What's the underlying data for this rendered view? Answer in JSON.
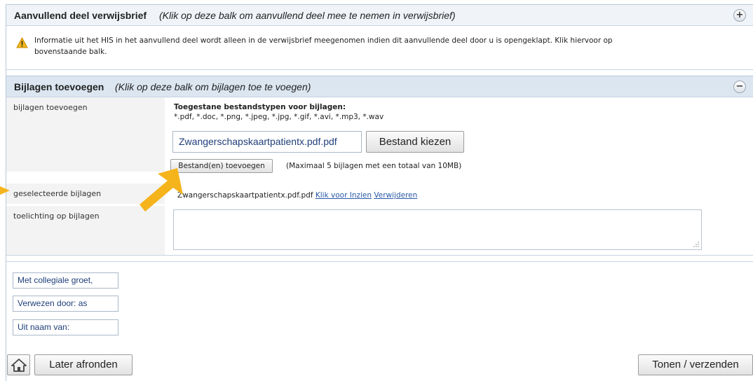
{
  "aanvullend": {
    "title": "Aanvullend deel verwijsbrief",
    "hint": "(Klik op deze balk om aanvullend deel mee te nemen in verwijsbrief)",
    "toggle": "+",
    "warning_line1": "Informatie uit het HIS in het aanvullend deel wordt alleen in de verwijsbrief meegenomen indien dit aanvullende deel door u is opengeklapt. Klik hiervoor op",
    "warning_line2": "bovenstaande balk."
  },
  "bijlagen": {
    "title": "Bijlagen toevoegen",
    "hint": "(Klik op deze balk om bijlagen toe te voegen)",
    "toggle": "−",
    "label_add": "bijlagen toevoegen",
    "allowed_title": "Toegestane bestandstypen voor bijlagen:",
    "allowed_types": "*.pdf, *.doc, *.png, *.jpeg, *.jpg, *.gif, *.avi, *.mp3, *.wav",
    "file_value": "Zwangerschapskaartpatientx.pdf.pdf",
    "choose_button": "Bestand kiezen",
    "add_button": "Bestand(en) toevoegen",
    "limit_note": "(Maximaal 5 bijlagen met een totaal van 10MB)",
    "label_selected": "geselecteerde bijlagen",
    "selected_file": "Zwangerschapskaartpatientx.pdf.pdf",
    "view_link": "Klik voor Inzien",
    "remove_link": "Verwijderen",
    "label_note": "toelichting op bijlagen",
    "note_value": ""
  },
  "signature": {
    "line1": "Met collegiale groet,",
    "line2": "Verwezen door: as",
    "line3": "Uit naam van:"
  },
  "footer": {
    "later_button": "Later afronden",
    "send_button": "Tonen / verzenden"
  },
  "colors": {
    "accent_arrow": "#f5b31c",
    "link": "#2a58a8",
    "header_bar": "#dbe6f1"
  }
}
